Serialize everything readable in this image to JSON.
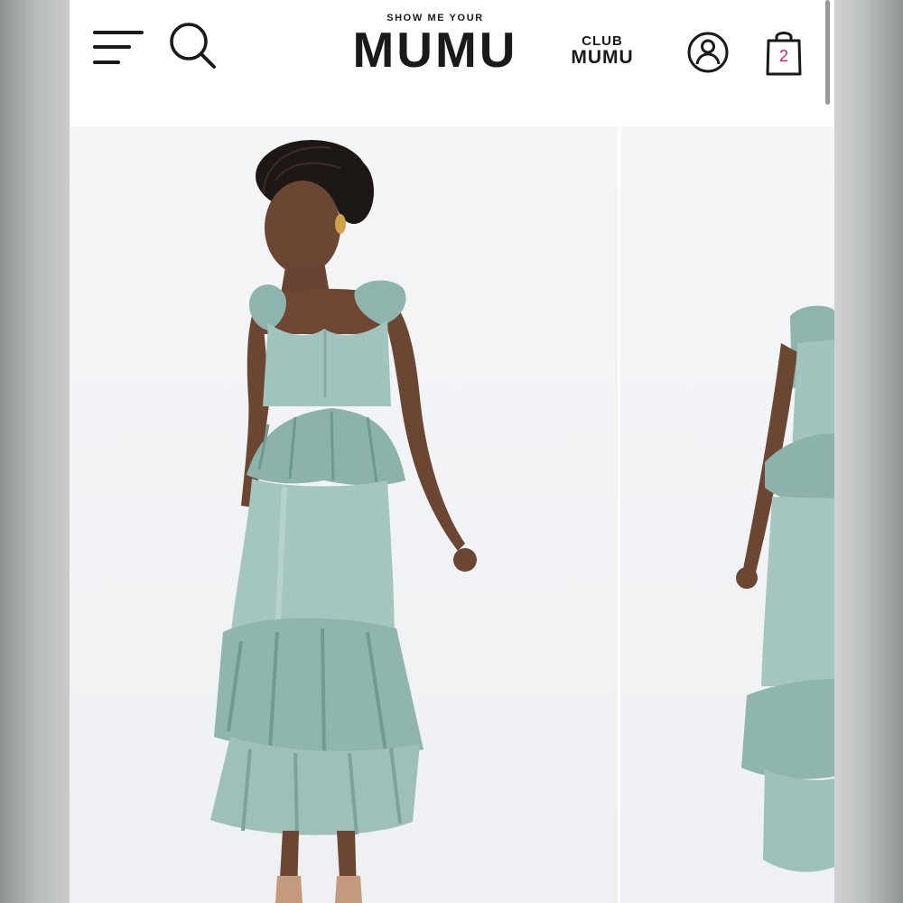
{
  "header": {
    "brand_top": "SHOW ME YOUR",
    "brand_main": "MUMU",
    "club_top": "CLUB",
    "club_main": "MUMU",
    "cart_count": "2"
  },
  "icons": {
    "menu": "hamburger-menu-icon",
    "search": "search-icon",
    "account": "account-icon",
    "cart": "shopping-bag-icon"
  },
  "colors": {
    "cart_badge": "#d81b60",
    "dress": "#9fc1bb",
    "page_background": "#ffffff",
    "photo_background": "#f2f3f5"
  },
  "gallery": {
    "images": [
      {
        "subject": "model-front-view"
      },
      {
        "subject": "model-side-view"
      }
    ]
  }
}
